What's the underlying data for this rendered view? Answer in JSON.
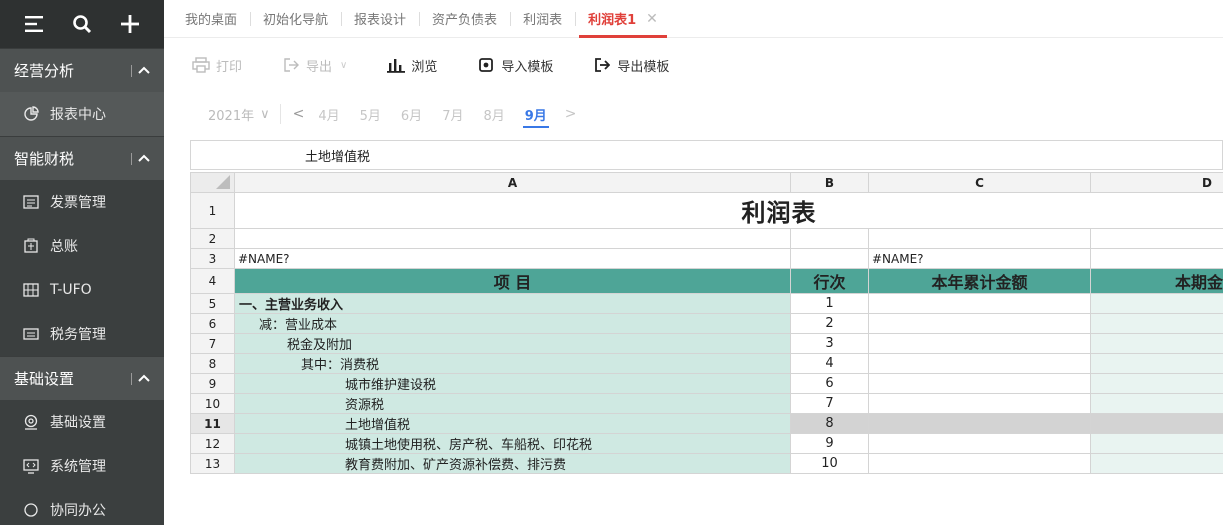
{
  "sidebar": {
    "tools": [
      "menu-icon",
      "search-icon",
      "plus-icon"
    ],
    "groups": [
      {
        "label": "经营分析",
        "items": [
          {
            "label": "报表中心",
            "icon": "report-center-icon"
          }
        ]
      },
      {
        "label": "智能财税",
        "items": [
          {
            "label": "发票管理",
            "icon": "invoice-icon"
          },
          {
            "label": "总账",
            "icon": "ledger-icon"
          },
          {
            "label": "T-UFO",
            "icon": "tufo-icon"
          },
          {
            "label": "税务管理",
            "icon": "tax-icon"
          }
        ]
      },
      {
        "label": "基础设置",
        "items": [
          {
            "label": "基础设置",
            "icon": "settings-icon"
          },
          {
            "label": "系统管理",
            "icon": "system-icon"
          },
          {
            "label": "协同办公",
            "icon": "collab-icon"
          }
        ]
      }
    ]
  },
  "tabs": [
    "我的桌面",
    "初始化导航",
    "报表设计",
    "资产负债表",
    "利润表",
    "利润表1"
  ],
  "active_tab": "利润表1",
  "toolbar": {
    "print": "打印",
    "export": "导出",
    "browse": "浏览",
    "import_template": "导入模板",
    "export_template": "导出模板"
  },
  "period": {
    "year": "2021年",
    "months": [
      "4月",
      "5月",
      "6月",
      "7月",
      "8月",
      "9月"
    ],
    "active_month": "9月"
  },
  "formula_bar": {
    "value": "土地增值税"
  },
  "grid": {
    "columns": [
      "A",
      "B",
      "C",
      "D"
    ],
    "title": "利润表",
    "row3_a": "#NAME?",
    "row3_c": "#NAME?",
    "header": [
      "项 目",
      "行次",
      "本年累计金额",
      "本期金额"
    ],
    "row_numbers": [
      "1",
      "2",
      "3",
      "4",
      "5",
      "6",
      "7",
      "8",
      "9",
      "10",
      "11",
      "12",
      "13"
    ],
    "selected_row": "11",
    "items": [
      {
        "label": "一、主营业务收入",
        "line": "1",
        "indent": 0,
        "bold": true
      },
      {
        "label": "减：营业成本",
        "line": "2",
        "indent": 1,
        "bold": false
      },
      {
        "label": "税金及附加",
        "line": "3",
        "indent": 2,
        "bold": false
      },
      {
        "label": "其中：消费税",
        "line": "4",
        "indent": 3,
        "bold": false
      },
      {
        "label": "城市维护建设税",
        "line": "6",
        "indent": 4,
        "bold": false
      },
      {
        "label": "资源税",
        "line": "7",
        "indent": 4,
        "bold": false
      },
      {
        "label": "土地增值税",
        "line": "8",
        "indent": 4,
        "bold": false
      },
      {
        "label": "城镇土地使用税、房产税、车船税、印花税",
        "line": "9",
        "indent": 4,
        "bold": false
      },
      {
        "label": "教育费附加、矿产资源补偿费、排污费",
        "line": "10",
        "indent": 4,
        "bold": false
      }
    ]
  }
}
